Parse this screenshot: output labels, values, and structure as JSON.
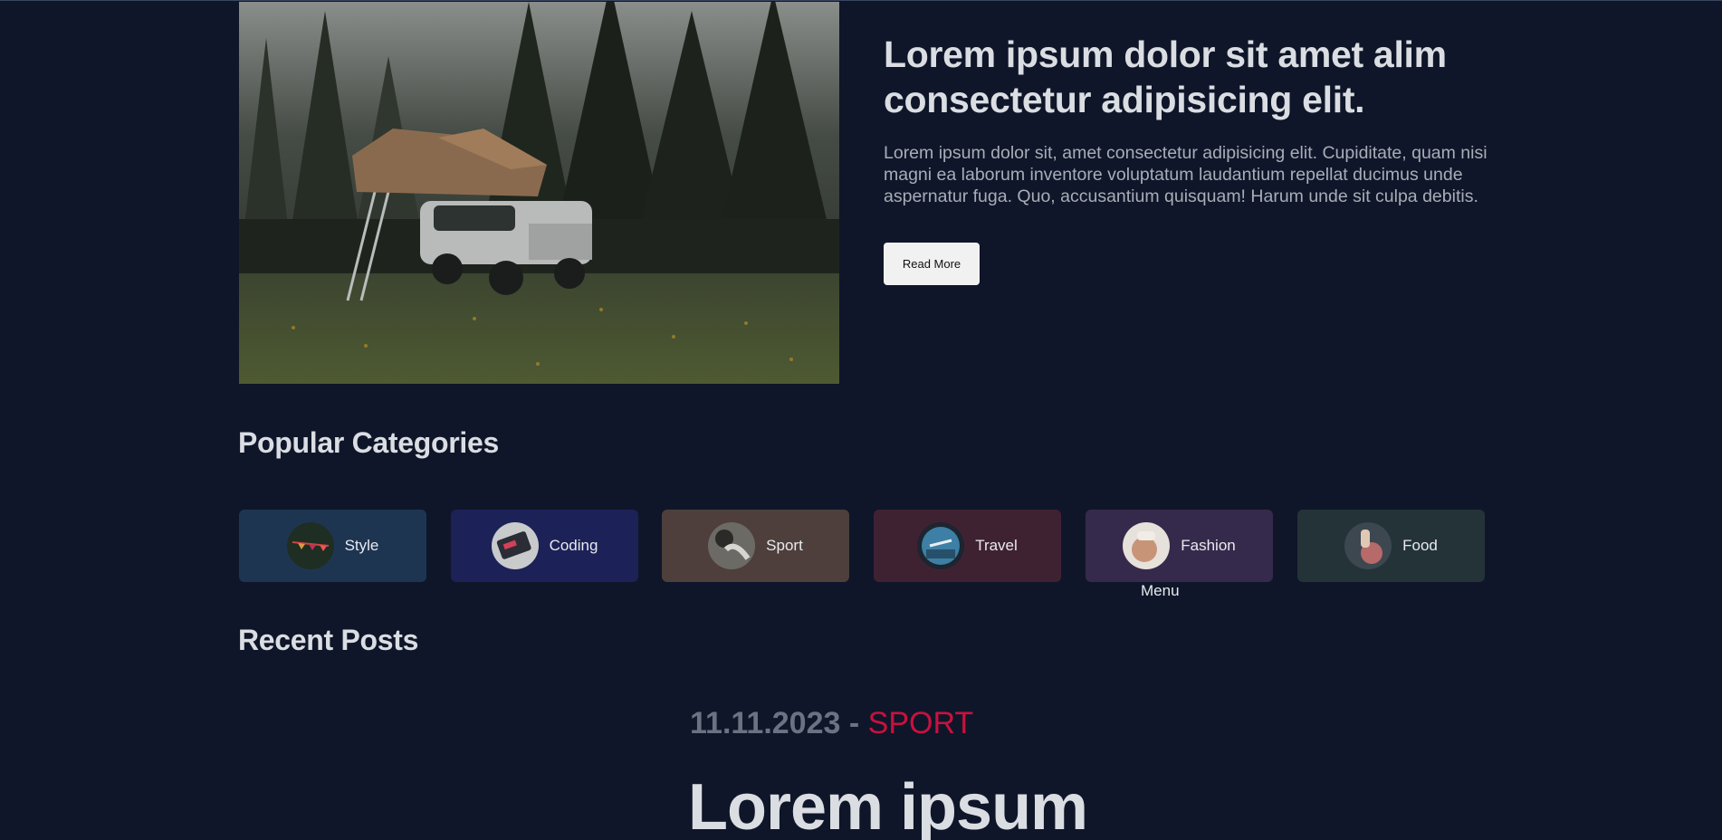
{
  "hero": {
    "title": "Lorem ipsum dolor sit amet alim consectetur adipisicing elit.",
    "description": "Lorem ipsum dolor sit, amet consectetur adipisicing elit. Cupiditate, quam nisi magni ea laborum inventore voluptatum laudantium repellat ducimus unde aspernatur fuga. Quo, accusantium quisquam! Harum unde sit culpa debitis.",
    "button_label": "Read More"
  },
  "categories": {
    "title": "Popular Categories",
    "items": [
      {
        "label": "Style",
        "bg": "#1e3552"
      },
      {
        "label": "Coding",
        "bg": "#1c2257"
      },
      {
        "label": "Sport",
        "bg": "#4e3f3c"
      },
      {
        "label": "Travel",
        "bg": "#3f2232"
      },
      {
        "label": "Fashion",
        "bg": "#352a4b"
      },
      {
        "label": "Food",
        "bg": "#233338"
      }
    ],
    "menu_label": "Menu"
  },
  "recent": {
    "title": "Recent Posts",
    "post": {
      "date": "11.11.2023",
      "separator": " - ",
      "category": "SPORT",
      "title": "Lorem ipsum"
    }
  },
  "colors": {
    "background": "#0f1629",
    "accent": "#c8113e"
  }
}
